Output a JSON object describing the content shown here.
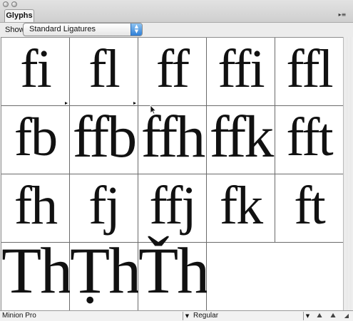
{
  "panel": {
    "tab_label": "Glyphs",
    "menu_icon": "panel-menu-icon"
  },
  "show": {
    "label": "Show",
    "selected": "Standard Ligatures"
  },
  "glyphs": [
    [
      "fi",
      "fl",
      "ff",
      "ffi",
      "ffl"
    ],
    [
      "fb",
      "ffb",
      "ffh",
      "ffk",
      "fft"
    ],
    [
      "fh",
      "fj",
      "ffj",
      "fk",
      "ft"
    ],
    [
      "Th",
      "Ṭh",
      "Ťh",
      ""
    ]
  ],
  "alternates_marker_on": [
    "fi",
    "fl"
  ],
  "footer": {
    "font_family": "Minion Pro",
    "font_style": "Regular"
  }
}
